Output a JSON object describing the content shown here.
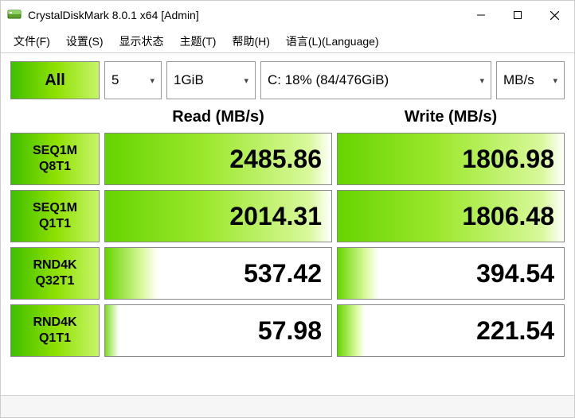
{
  "window": {
    "title": "CrystalDiskMark 8.0.1 x64 [Admin]"
  },
  "menu": {
    "file": "文件(F)",
    "settings": "设置(S)",
    "display": "显示状态",
    "theme": "主题(T)",
    "help": "帮助(H)",
    "language": "语言(L)(Language)"
  },
  "controls": {
    "all_label": "All",
    "count": "5",
    "size": "1GiB",
    "drive": "C: 18% (84/476GiB)",
    "unit": "MB/s"
  },
  "headers": {
    "read": "Read (MB/s)",
    "write": "Write (MB/s)"
  },
  "tests": [
    {
      "line1": "SEQ1M",
      "line2": "Q8T1",
      "read": "2485.86",
      "write": "1806.98",
      "rfill": "full",
      "wfill": "full"
    },
    {
      "line1": "SEQ1M",
      "line2": "Q1T1",
      "read": "2014.31",
      "write": "1806.48",
      "rfill": "full",
      "wfill": "full"
    },
    {
      "line1": "RND4K",
      "line2": "Q32T1",
      "read": "537.42",
      "write": "394.54",
      "rfill": "20",
      "wfill": "15"
    },
    {
      "line1": "RND4K",
      "line2": "Q1T1",
      "read": "57.98",
      "write": "221.54",
      "rfill": "5",
      "wfill": "10"
    }
  ],
  "statusbar": ""
}
